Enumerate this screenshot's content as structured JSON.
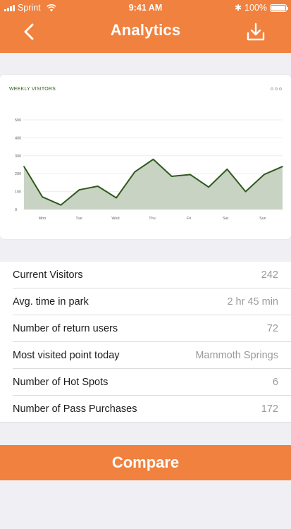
{
  "status_bar": {
    "carrier": "Sprint",
    "time": "9:41 AM",
    "battery": "100%"
  },
  "header": {
    "title": "Analytics",
    "back_icon": "chevron-left-icon",
    "download_icon": "download-icon"
  },
  "colors": {
    "accent": "#f0813e",
    "chart_line": "#2e5a1c",
    "chart_fill": "#c9d3c4",
    "value_text": "#9a9a9a"
  },
  "chart_data": {
    "type": "area",
    "title": "WEEKLY VISITORS",
    "x_tick_labels": [
      "Mon",
      "Tue",
      "Wed",
      "Thu",
      "Fri",
      "Sat",
      "Sun"
    ],
    "y_tick_labels": [
      "0",
      "100",
      "200",
      "300",
      "400",
      "500"
    ],
    "ylim": [
      0,
      500
    ],
    "grid": true,
    "x": [
      0,
      0.5,
      1,
      1.5,
      2,
      2.5,
      3,
      3.5,
      4,
      4.5,
      5,
      5.5,
      6,
      6.5,
      7,
      7.5,
      8
    ],
    "x_index_labels": {
      "1": "Mon",
      "2": "Tue",
      "3": "Wed",
      "4": "Thu",
      "5": "Fri",
      "6": "Sat",
      "7": "Sun"
    },
    "series": [
      {
        "values": [
          240,
          70,
          25,
          110,
          130,
          65,
          210,
          280,
          185,
          195,
          125,
          225,
          100,
          195,
          240
        ]
      }
    ]
  },
  "stats": [
    {
      "label": "Current Visitors",
      "value": "242"
    },
    {
      "label": "Avg. time in park",
      "value": "2 hr 45 min"
    },
    {
      "label": "Number of return users",
      "value": "72"
    },
    {
      "label": "Most visited point today",
      "value": "Mammoth Springs"
    },
    {
      "label": "Number of Hot Spots",
      "value": "6"
    },
    {
      "label": "Number of Pass Purchases",
      "value": "172"
    }
  ],
  "compare_button": {
    "label": "Compare"
  }
}
